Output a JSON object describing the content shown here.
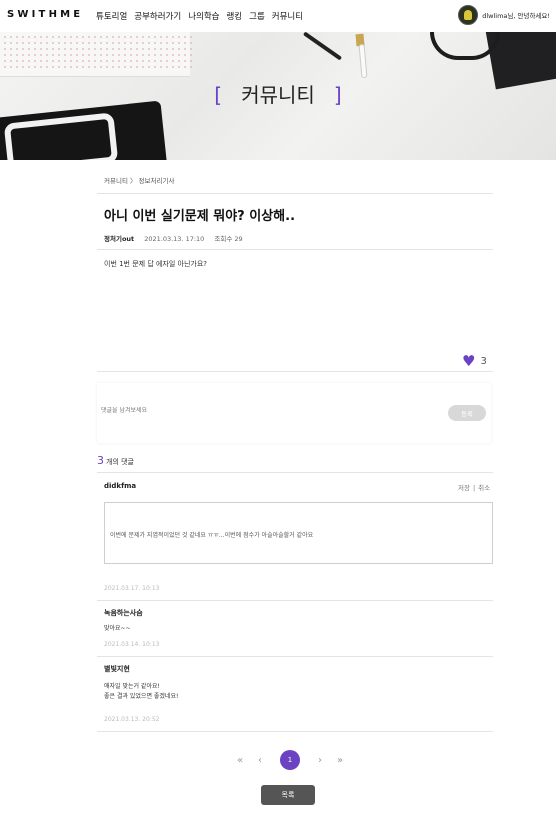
{
  "header": {
    "logo": "SWITHME",
    "nav": [
      "튜토리얼",
      "공부하러가기",
      "나의학습",
      "랭킹",
      "그룹",
      "커뮤니티"
    ],
    "greeting": "dlwlima님, 안녕하세요!"
  },
  "banner": {
    "bracket_left": "[",
    "title": "커뮤니티",
    "bracket_right": "]"
  },
  "breadcrumb": "커뮤니티 〉 정보처리기사",
  "post": {
    "title": "아니 이번 실기문제 뭐야? 이상해..",
    "author": "정처기out",
    "date": "2021.03.13. 17:10",
    "views": "조회수 29",
    "body": "이번 1번 문제 답 에자일 아닌가요?",
    "likes": "3"
  },
  "comment_form": {
    "placeholder": "댓글을 남겨보세요",
    "submit": "등록"
  },
  "comments_header": {
    "count": "3",
    "label": "개의 댓글"
  },
  "editing": {
    "author": "didkfma",
    "save": "저장",
    "separator": "|",
    "cancel": "취소",
    "text": "이번에 문제가 지엽적이었던 것 같네요 ㅠㅠ...이번에 점수가 아슬아슬할거 같아요",
    "date": "2021.03.17. 10:13"
  },
  "comments": [
    {
      "name": "녹음하는사슴",
      "lines": [
        "맞아요~~"
      ],
      "date": "2021.03.14. 10:13"
    },
    {
      "name": "별빛지현",
      "lines": [
        "애자일 맞는거 같아요!",
        "좋은 결과 있었으면 좋겠네요!"
      ],
      "date": "2021.03.13. 20:52"
    }
  ],
  "pagination": {
    "first": "«",
    "prev": "‹",
    "current": "1",
    "next": "›",
    "last": "»"
  },
  "list_button": "목록",
  "colors": {
    "accent": "#6a42c2"
  }
}
